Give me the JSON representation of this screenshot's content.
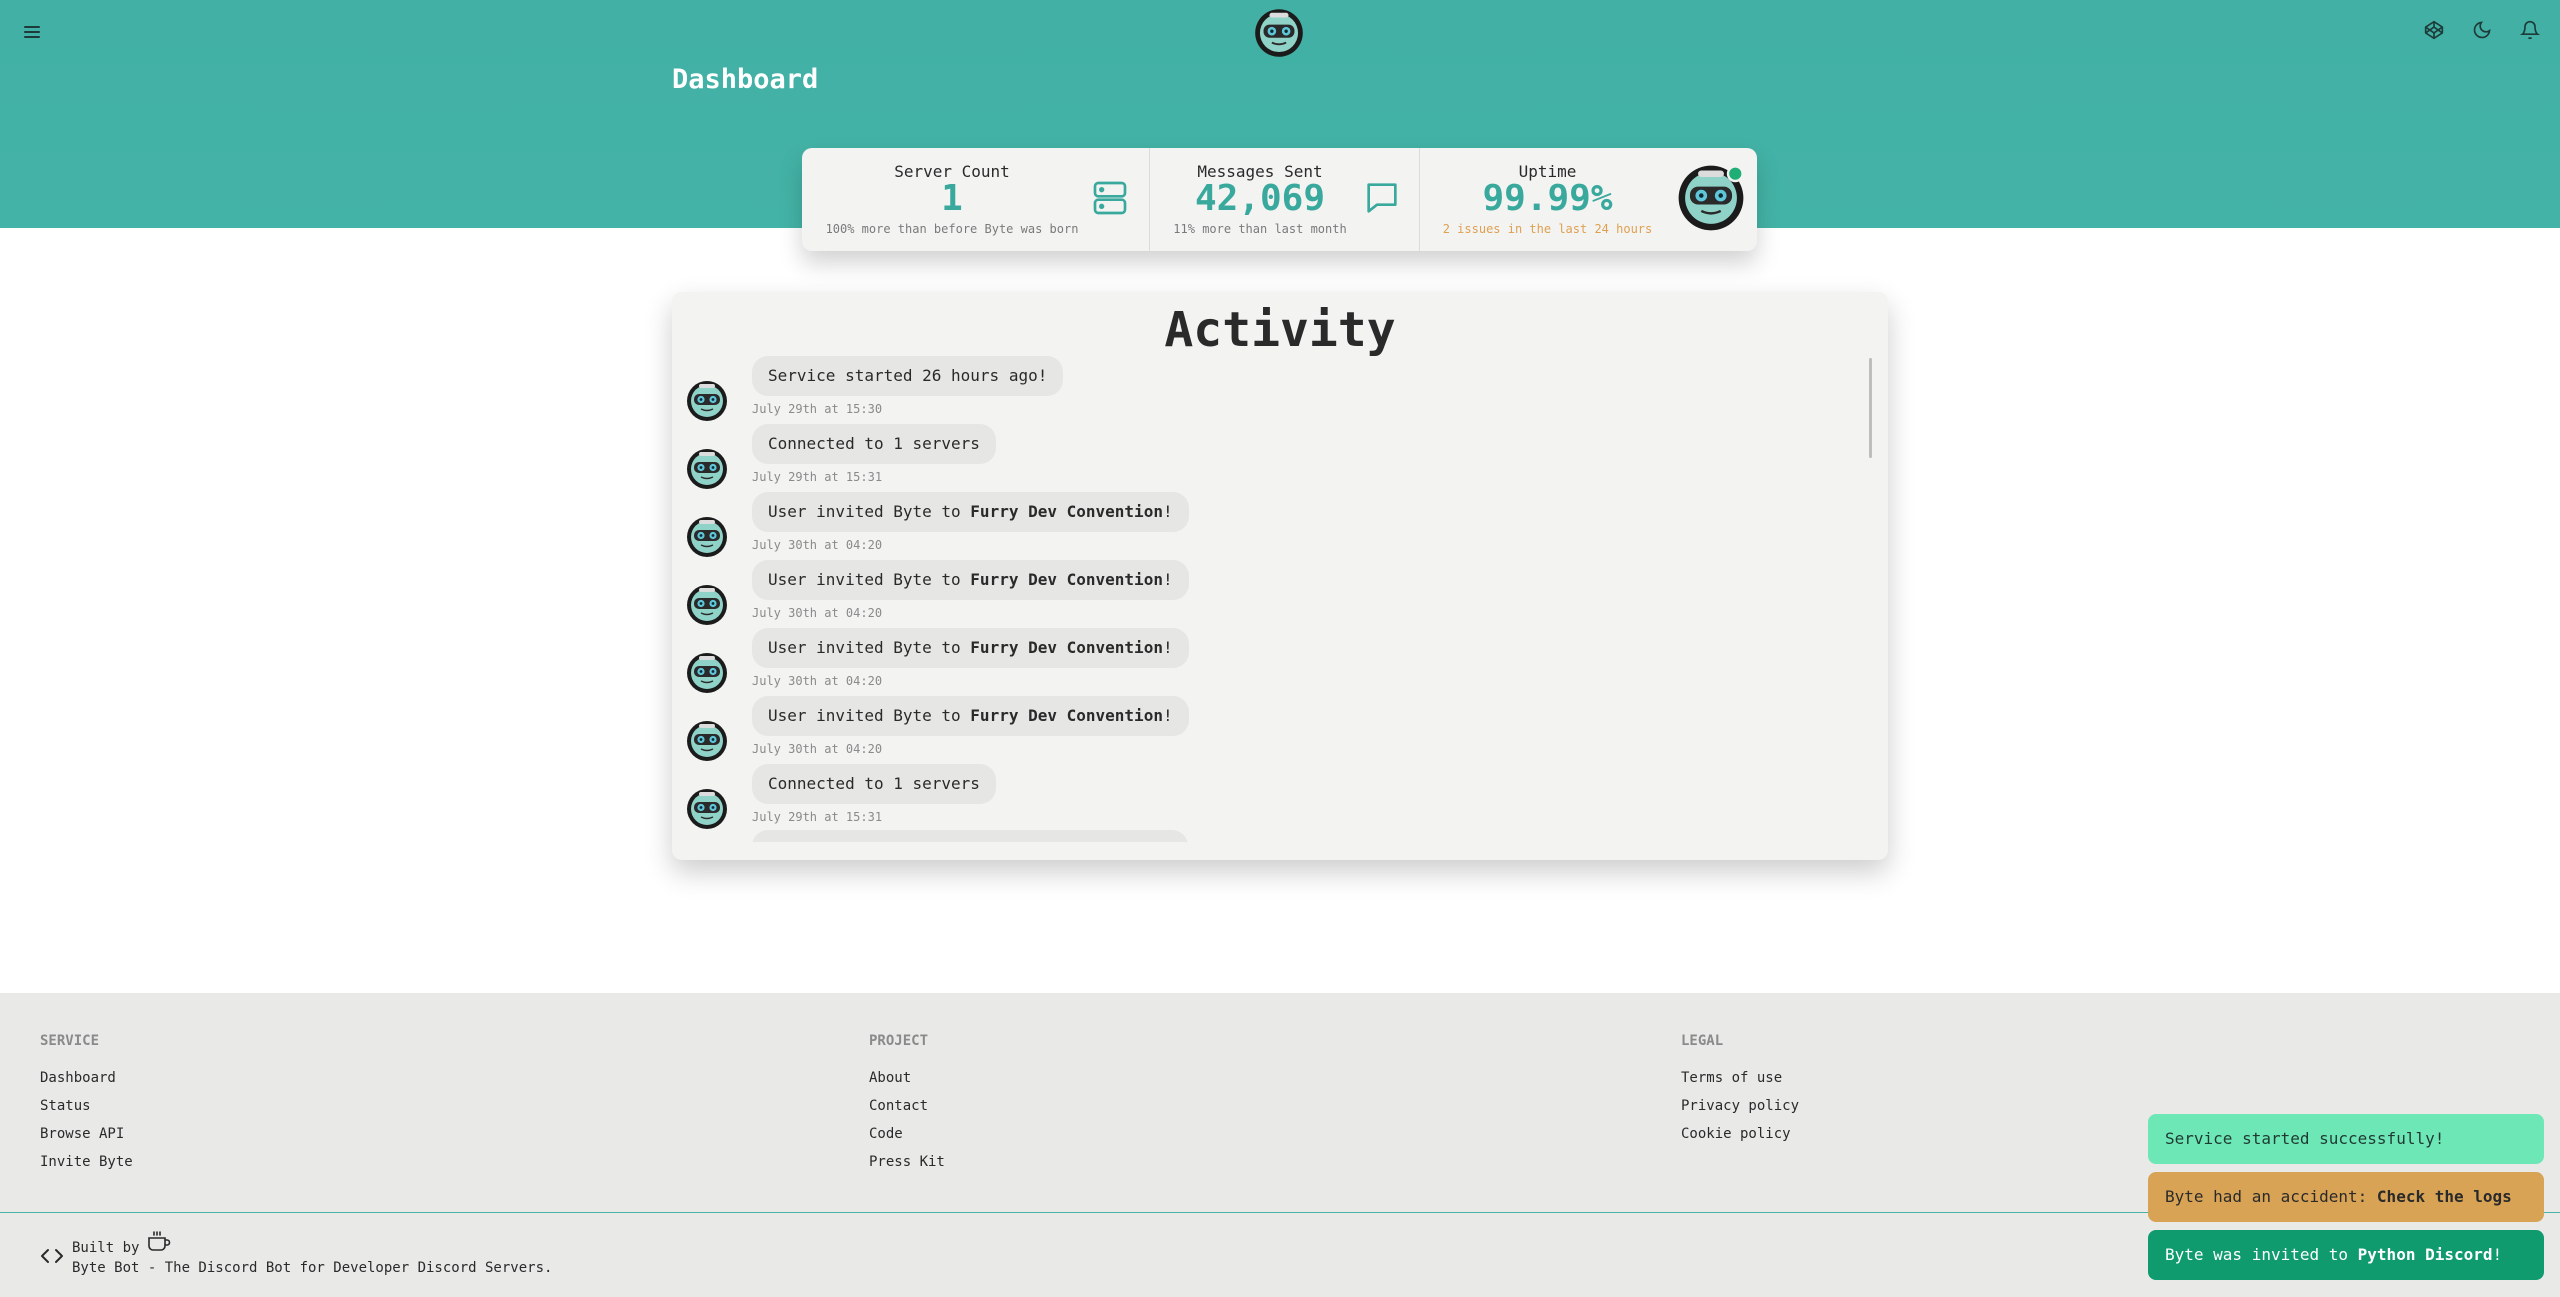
{
  "header": {
    "title": "Dashboard",
    "menu_icon": "hamburger-menu-icon",
    "logo_icon": "byte-bot-avatar-logo",
    "icons": [
      "codepen-cube-icon",
      "moon-icon",
      "bell-icon"
    ]
  },
  "stats": {
    "server_count": {
      "title": "Server Count",
      "value": "1",
      "desc": "100% more than before Byte was born",
      "icon": "server-icon"
    },
    "messages_sent": {
      "title": "Messages Sent",
      "value": "42,069",
      "desc": "11% more than last month",
      "icon": "chat-bubble-icon"
    },
    "uptime": {
      "title": "Uptime",
      "value": "99.99%",
      "desc": "2 issues in the last 24 hours",
      "icon": "byte-bot-avatar-online"
    }
  },
  "activity": {
    "title": "Activity",
    "items": [
      {
        "prefix": "Service started 26 hours ago!",
        "bold": "",
        "suffix": "",
        "time": "July 29th at 15:30"
      },
      {
        "prefix": "Connected to 1 servers",
        "bold": "",
        "suffix": "",
        "time": "July 29th at 15:31"
      },
      {
        "prefix": "User invited Byte to ",
        "bold": "Furry Dev Convention",
        "suffix": "!",
        "time": "July 30th at 04:20"
      },
      {
        "prefix": "User invited Byte to ",
        "bold": "Furry Dev Convention",
        "suffix": "!",
        "time": "July 30th at 04:20"
      },
      {
        "prefix": "User invited Byte to ",
        "bold": "Furry Dev Convention",
        "suffix": "!",
        "time": "July 30th at 04:20"
      },
      {
        "prefix": "User invited Byte to ",
        "bold": "Furry Dev Convention",
        "suffix": "!",
        "time": "July 30th at 04:20"
      },
      {
        "prefix": "Connected to 1 servers",
        "bold": "",
        "suffix": "",
        "time": "July 29th at 15:31"
      }
    ]
  },
  "footer": {
    "service": {
      "heading": "SERVICE",
      "links": [
        "Dashboard",
        "Status",
        "Browse API",
        "Invite Byte"
      ]
    },
    "project": {
      "heading": "PROJECT",
      "links": [
        "About",
        "Contact",
        "Code",
        "Press Kit"
      ]
    },
    "legal": {
      "heading": "LEGAL",
      "links": [
        "Terms of use",
        "Privacy policy",
        "Cookie policy"
      ]
    },
    "built_by": "Built by",
    "tagline": "Byte Bot - The Discord Bot for Developer Discord Servers."
  },
  "toasts": [
    {
      "prefix": "Service started successfully!",
      "bold": "",
      "suffix": ""
    },
    {
      "prefix": "Byte had an accident: ",
      "bold": "Check the logs",
      "suffix": ""
    },
    {
      "prefix": "Byte was invited to ",
      "bold": "Python Discord",
      "suffix": "!"
    }
  ],
  "colors": {
    "teal": "#44b3a7",
    "accent_value": "#3aa99d",
    "warning": "#e0a050",
    "toast_success_light": "#6ee7b7",
    "toast_warning": "#d9a356",
    "toast_success_dark": "#0f9b6e"
  }
}
